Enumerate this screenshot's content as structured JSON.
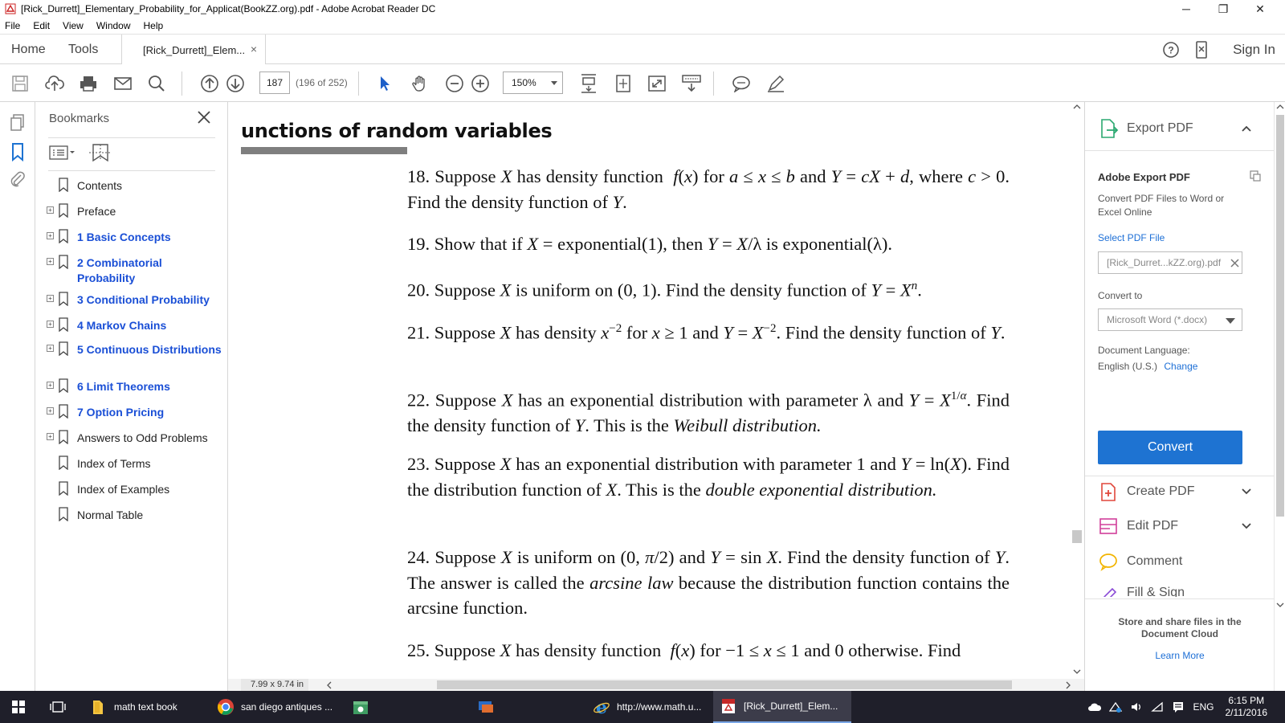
{
  "window": {
    "title": "[Rick_Durrett]_Elementary_Probability_for_Applicat(BookZZ.org).pdf - Adobe Acrobat Reader DC",
    "minimize": "─",
    "restore": "❐",
    "close": "✕"
  },
  "menus": [
    "File",
    "Edit",
    "View",
    "Window",
    "Help"
  ],
  "tabs": {
    "home": "Home",
    "tools": "Tools",
    "document": "[Rick_Durrett]_Elem...",
    "document_close": "×",
    "sign_in": "Sign In"
  },
  "toolbar": {
    "page_number": "187",
    "page_count": "(196 of 252)",
    "zoom": "150%"
  },
  "bookmarks": {
    "header": "Bookmarks",
    "items": [
      {
        "label": "Contents",
        "expandable": false,
        "blue": false
      },
      {
        "label": "Preface",
        "expandable": true,
        "blue": false
      },
      {
        "label": "1 Basic Concepts",
        "expandable": true,
        "blue": true
      },
      {
        "label": "2 Combinatorial Probability",
        "expandable": true,
        "blue": true
      },
      {
        "label": "3 Conditional Probability",
        "expandable": true,
        "blue": true
      },
      {
        "label": "4 Markov Chains",
        "expandable": true,
        "blue": true
      },
      {
        "label": "5 Continuous Distributions",
        "expandable": true,
        "blue": true
      },
      {
        "label": "6 Limit Theorems",
        "expandable": true,
        "blue": true
      },
      {
        "label": "7 Option Pricing",
        "expandable": true,
        "blue": true
      },
      {
        "label": "Answers to Odd Problems",
        "expandable": true,
        "blue": false
      },
      {
        "label": "Index of Terms",
        "expandable": false,
        "blue": false
      },
      {
        "label": "Index of Examples",
        "expandable": false,
        "blue": false
      },
      {
        "label": "Normal Table",
        "expandable": false,
        "blue": false
      }
    ]
  },
  "document": {
    "heading": "unctions of random variables",
    "page_size": "7.99 x 9.74 in"
  },
  "right_panel": {
    "export_pdf": "Export PDF",
    "section_title": "Adobe Export PDF",
    "description": "Convert PDF Files to Word or Excel Online",
    "select_file": "Select PDF File",
    "file_name": "[Rick_Durret...kZZ.org).pdf",
    "convert_to": "Convert to",
    "format": "Microsoft Word (*.docx)",
    "doc_language_label": "Document Language:",
    "doc_language": "English (U.S.)",
    "change": "Change",
    "convert_button": "Convert",
    "create_pdf": "Create PDF",
    "edit_pdf": "Edit PDF",
    "comment": "Comment",
    "fill_sign": "Fill & Sign",
    "cloud_text": "Store and share files in the Document Cloud",
    "learn_more": "Learn More"
  },
  "taskbar": {
    "items": [
      "math text book",
      "san diego antiques ...",
      "http://www.math.u...",
      "[Rick_Durrett]_Elem..."
    ],
    "language": "ENG",
    "time": "6:15 PM",
    "date": "2/11/2016"
  },
  "colors": {
    "accent_blue": "#1e73d2",
    "bookmark_blue": "#1a4fd6",
    "taskbar": "#1f1f2a"
  }
}
